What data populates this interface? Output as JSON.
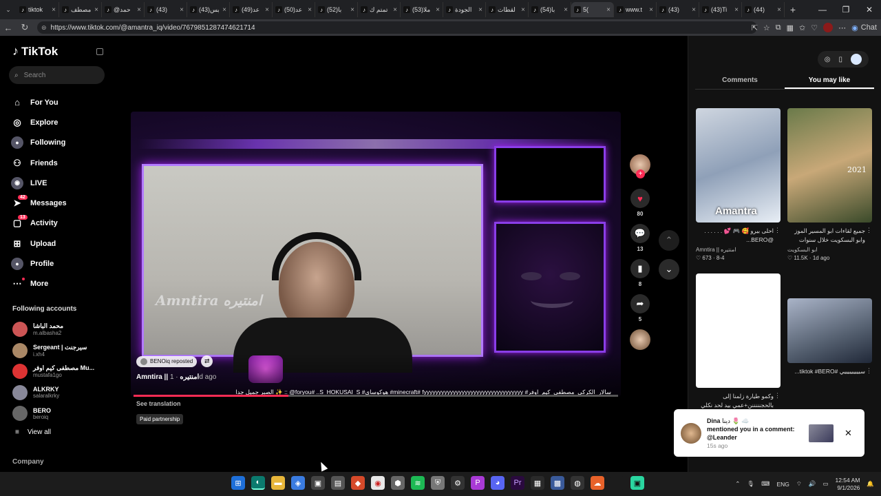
{
  "browser": {
    "tabs": [
      {
        "label": "tiktok"
      },
      {
        "label": "مصطف"
      },
      {
        "label": "@حمد"
      },
      {
        "label": "(43)"
      },
      {
        "label": "(43)يس"
      },
      {
        "label": "(49)عد"
      },
      {
        "label": "(50)عد"
      },
      {
        "label": "(52)با"
      },
      {
        "label": "تمتم ك"
      },
      {
        "label": "(53)ملا"
      },
      {
        "label": "الجودة"
      },
      {
        "label": "لقطات"
      },
      {
        "label": "(54)با"
      },
      {
        "label": "5(",
        "active": true
      },
      {
        "label": "www.t"
      },
      {
        "label": "(43)"
      },
      {
        "label": "(43)Ti"
      },
      {
        "label": "(44)"
      }
    ],
    "url": "https://www.tiktok.com/@amantra_iq/video/7679851287474621714",
    "chat_label": "Chat"
  },
  "sidebar": {
    "logo": "TikTok",
    "search_placeholder": "Search",
    "nav": [
      {
        "label": "For You",
        "icon": "home-icon"
      },
      {
        "label": "Explore",
        "icon": "compass-icon"
      },
      {
        "label": "Following",
        "icon": "following-avatar-icon"
      },
      {
        "label": "Friends",
        "icon": "friends-icon"
      },
      {
        "label": "LIVE",
        "icon": "live-icon"
      },
      {
        "label": "Messages",
        "icon": "messages-icon",
        "badge": "42"
      },
      {
        "label": "Activity",
        "icon": "activity-icon",
        "badge": "13"
      },
      {
        "label": "Upload",
        "icon": "upload-icon"
      },
      {
        "label": "Profile",
        "icon": "profile-icon"
      },
      {
        "label": "More",
        "icon": "more-icon"
      }
    ],
    "following_title": "Following accounts",
    "accounts": [
      {
        "name": "محمد الباشا",
        "handle": "m.albasha2"
      },
      {
        "name": "Sergeant | سيرجنت",
        "handle": "i.xh4"
      },
      {
        "name": "مصطفى كيم اوفر Mu...",
        "handle": "mustafa1go"
      },
      {
        "name": "ALKRKY",
        "handle": "salaralkrky"
      },
      {
        "name": "BERO",
        "handle": "beroiq"
      }
    ],
    "view_all": "View all",
    "company": "Company"
  },
  "video": {
    "watermark": "Amntira امنتيره",
    "repost_label": "BENOiq reposted",
    "author": "Amntira || امنتيره",
    "time": " · 1d ago",
    "caption": "سالار_الكركي_مصطفى_كيم_اوفر# minecraft# fyyyyyyyyyyyyyyyyyyyyyyyyyyyyyyyyyy# هوكوساي# foryou# ..S_HOKUSAI_S@ :: ✨ الصبر جميل جدا",
    "see_translation": "See translation",
    "paid": "Paid partnership",
    "progress": 0.32
  },
  "actions": {
    "likes": "80",
    "comments": "13",
    "saves": "8",
    "shares": "5"
  },
  "right_panel": {
    "tabs": [
      "Comments",
      "You may like"
    ],
    "active_tab": 1,
    "cards": [
      {
        "title": "احلى بيرو 🥰 🎮 💕 . . . . . . @BERO...",
        "author": "Amntira || امنتيره",
        "meta": "♡ 673 · 8-4",
        "thumb_text": "Amantra"
      },
      {
        "title": "جميع لقاءات ابو المسير الموز وابو البسكويت خلال سنوات التطوروا",
        "author": "ابو البسكويت",
        "meta": "♡ 11.5K · 1d ago",
        "thumb_text": "2021"
      },
      {
        "title": "وكمو طيارة زلمنا إلى بالحجنننننن+عمي بيد لحد نكلي",
        "author": "",
        "meta": "",
        "thumb_text": ""
      },
      {
        "title": "سيييييييييي #tiktok #BERO...",
        "author": "",
        "meta": "",
        "thumb_text": ""
      }
    ]
  },
  "toast": {
    "name": "Dina",
    "name_suffix": " دينا 🌷 ☁️",
    "message": "mentioned you in a comment: @Leander",
    "time": "15s ago"
  },
  "taskbar": {
    "lang": "ENG",
    "time": "12:54 AM",
    "date": "9/1/2026"
  },
  "colors": {
    "accent": "#fe2c55",
    "background": "#000000",
    "panel": "#121212"
  }
}
